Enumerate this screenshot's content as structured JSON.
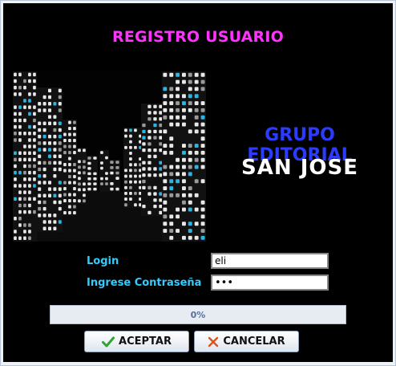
{
  "form": {
    "title": "REGISTRO USUARIO",
    "brand_line1": "GRUPO EDITORIAL",
    "brand_line2": "SAN JOSE",
    "login_label": "Login",
    "login_value": "eli",
    "password_label": "Ingrese Contraseña",
    "password_value": "•••",
    "progress_text": "0%",
    "progress_value": 0,
    "accept_label": "ACEPTAR",
    "cancel_label": "CANCELAR"
  },
  "icons": {
    "accept": "checkmark-icon",
    "cancel": "cross-icon",
    "image": "city-buildings-image"
  },
  "colors": {
    "title": "#ff33ff",
    "brand_line1": "#2b3cff",
    "brand_line2": "#ffffff",
    "labels": "#33ccff",
    "background": "#000000"
  }
}
